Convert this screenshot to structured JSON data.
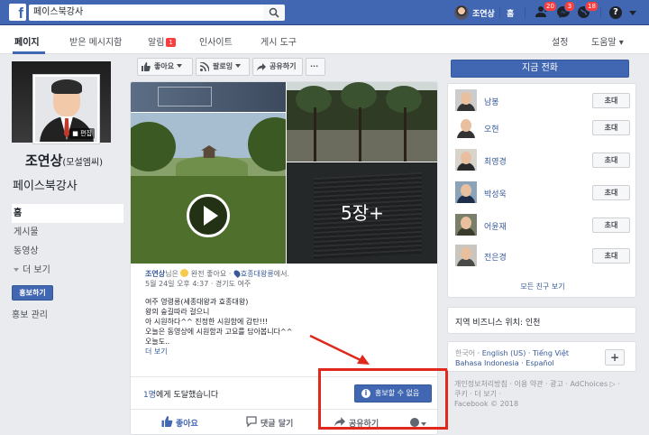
{
  "topbar": {
    "search_value": "페이스북강사",
    "user_name": "조연상",
    "home_label": "홈",
    "badges": {
      "friends": "20",
      "messages": "3",
      "notifications": "18"
    },
    "help_glyph": "?"
  },
  "subnav": {
    "items": [
      "페이지",
      "받은 메시지함",
      "알림",
      "인사이트",
      "게시 도구"
    ],
    "notif_badge": "1",
    "right_items": [
      "설정",
      "도움말 ▾"
    ]
  },
  "profile": {
    "name": "조연상",
    "name_sub": "(모설엠씨)",
    "edit_label": "편집",
    "handle": "페이스북강사"
  },
  "leftnav": {
    "items": [
      "홈",
      "게시물",
      "동영상",
      "더 보기"
    ],
    "promote_button": "홍보하기",
    "promote_manage": "홍보 관리"
  },
  "actions": {
    "like": "좋아요",
    "follow": "팔로잉",
    "share": "공유하기",
    "more": "···"
  },
  "post": {
    "more_photos": "5장+",
    "author": "조연상",
    "feeling_prefix": "님은",
    "feeling_text": "완전 좋아요",
    "at_prefix": "·",
    "location": "효종대왕릉",
    "location_suffix": "에서.",
    "date_line": "5월 24일 오후 4:37 · 경기도 여주",
    "lines": [
      "여주 영령릉(세종대왕과 효종대왕)",
      "왕의 숲길따라 걸으니",
      "아 시원하다^^ 진정한 시원함에 감탄!!!",
      "오늘은 동영상에 시원함과 고요를 담아봅니다^^",
      "오늘도.."
    ],
    "see_more": "더 보기",
    "reach_count": "1명",
    "reach_suffix": "에게 도달했습니다",
    "boost_label": "홍보할 수 없음",
    "bottom_like": "좋아요",
    "bottom_comment": "댓글 달기",
    "bottom_share": "공유하기"
  },
  "right": {
    "call_button": "지금 전화",
    "friends": [
      {
        "name": "남봉",
        "invite": "초대"
      },
      {
        "name": "오현",
        "invite": "초대"
      },
      {
        "name": "최영경",
        "invite": "초대"
      },
      {
        "name": "박성욱",
        "invite": "초대"
      },
      {
        "name": "어윤재",
        "invite": "초대"
      },
      {
        "name": "전은경",
        "invite": "초대"
      }
    ],
    "see_all": "모든 친구 보기",
    "biz_text": "지역 비즈니스 위치: 인천",
    "lang_current": "한국어",
    "lang_line1": "English (US) · Tiếng Việt",
    "lang_line2": "Bahasa Indonesia · Español",
    "footer_line1": "개인정보처리방침 · 이용 약관 · 광고 · AdChoices ▷ ·",
    "footer_line2": "쿠키 · 더 보기 ·",
    "footer_line3": "Facebook © 2018"
  },
  "colors": {
    "brand": "#4267b2",
    "highlight": "#e0281c",
    "badge": "#fa3e3e"
  }
}
